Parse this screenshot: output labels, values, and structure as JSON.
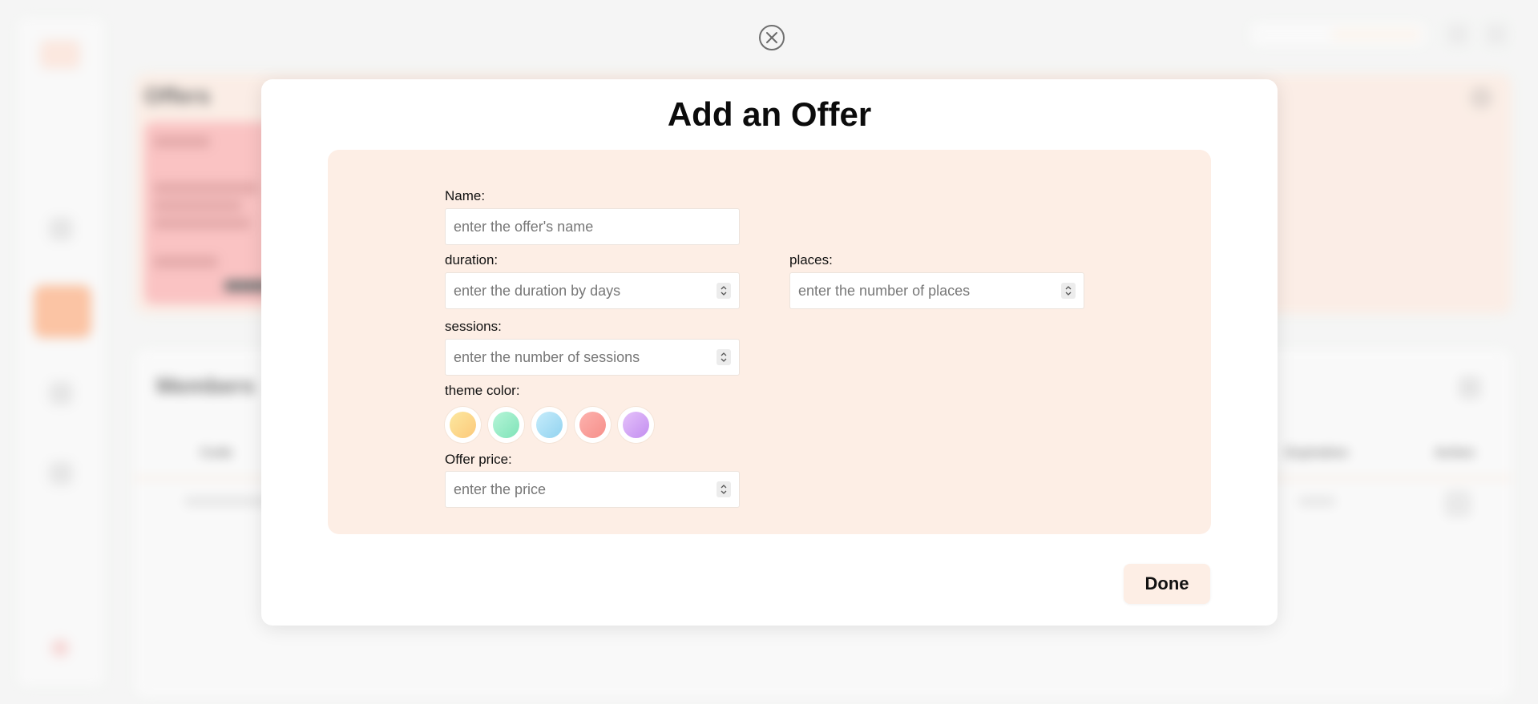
{
  "background": {
    "offers_title": "Offers",
    "members_title": "Members",
    "columns": [
      "Code",
      "Expiration",
      "Action"
    ]
  },
  "modal": {
    "title": "Add an Offer",
    "fields": {
      "name": {
        "label": "Name:",
        "placeholder": "enter the offer's name"
      },
      "duration": {
        "label": "duration:",
        "placeholder": "enter the duration by days"
      },
      "places": {
        "label": "places:",
        "placeholder": "enter the number of places"
      },
      "sessions": {
        "label": "sessions:",
        "placeholder": "enter the number of sessions"
      },
      "price": {
        "label": "Offer price:",
        "placeholder": "enter the price"
      }
    },
    "theme_color": {
      "label": "theme color:",
      "options": [
        {
          "name": "yellow",
          "from": "#fde8a0",
          "to": "#fbc97a"
        },
        {
          "name": "green",
          "from": "#b6f5d8",
          "to": "#7fe3b8"
        },
        {
          "name": "blue",
          "from": "#c6ecfb",
          "to": "#92d3f0"
        },
        {
          "name": "red",
          "from": "#fdb2ae",
          "to": "#f68f8a"
        },
        {
          "name": "purple",
          "from": "#e5c2fa",
          "to": "#c38ef0"
        }
      ]
    },
    "done_label": "Done"
  }
}
